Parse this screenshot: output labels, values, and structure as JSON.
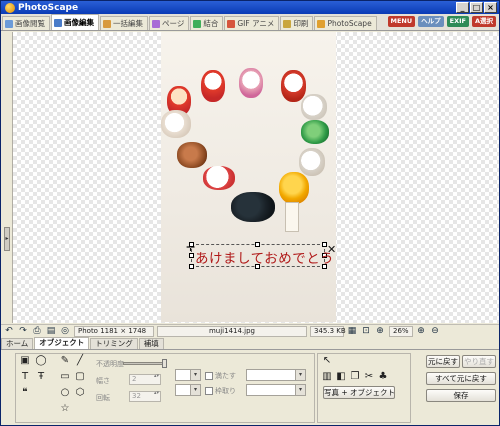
{
  "app": {
    "title": "PhotoScape"
  },
  "titlebar": {
    "min": "_",
    "max": "□",
    "close": "×"
  },
  "tabs": [
    {
      "label": "画像閲覧",
      "color": "#6c9bd8",
      "active": false
    },
    {
      "label": "画像編集",
      "color": "#4a7cc9",
      "active": true
    },
    {
      "label": "一括編集",
      "color": "#d89a3e",
      "active": false
    },
    {
      "label": "ページ",
      "color": "#a86bd6",
      "active": false
    },
    {
      "label": "結合",
      "color": "#3fae5a",
      "active": false
    },
    {
      "label": "GIF アニメ",
      "color": "#d6553e",
      "active": false
    },
    {
      "label": "印刷",
      "color": "#c9a63e",
      "active": false
    },
    {
      "label": "PhotoScape",
      "color": "#e0a030",
      "active": false
    }
  ],
  "top_badges": [
    {
      "label": "MENU",
      "color": "#c0392b"
    },
    {
      "label": "ヘルプ",
      "color": "#6b8fbd"
    },
    {
      "label": "EXIF",
      "color": "#2e8b57"
    },
    {
      "label": "A選択",
      "color": "#c0392b"
    }
  ],
  "greeting_text": "あけましておめでとう",
  "status": {
    "photo_info": "Photo 1181 × 1748",
    "filename": "muji1414.jpg",
    "filesize": "345.3 KB",
    "zoom": "26%"
  },
  "subtabs": [
    {
      "label": "ホーム",
      "active": false
    },
    {
      "label": "オブジェクト",
      "active": true
    },
    {
      "label": "トリミング",
      "active": false
    },
    {
      "label": "補填",
      "active": false
    }
  ],
  "object_panel": {
    "opacity_label": "不透明度",
    "thickness_label": "幅さ",
    "thickness_value": "2",
    "rotation_label": "回転",
    "rotation_value": "32",
    "fill_label": "満たす",
    "outline_label": "枠取り",
    "photo_object_button": "写真 + オブジェクト"
  },
  "actions": {
    "undo": "元に戻す",
    "redo": "やり直す",
    "undo_all": "すべて元に戻す",
    "save": "保存"
  }
}
